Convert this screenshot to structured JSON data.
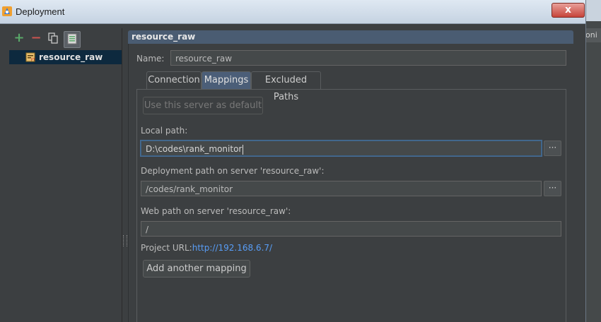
{
  "window": {
    "title": "Deployment",
    "close_label": "x"
  },
  "background": {
    "right_tab_text": "oni"
  },
  "sidebar": {
    "toolbar": {
      "add_label": "+",
      "remove_label": "−"
    },
    "servers": [
      {
        "label": "resource_raw"
      }
    ]
  },
  "panel": {
    "header": "resource_raw",
    "name_label": "Name:",
    "name_value": "resource_raw",
    "tabs": [
      {
        "label": "Connection"
      },
      {
        "label": "Mappings"
      },
      {
        "label": "Excluded Paths"
      }
    ],
    "use_default_label": "Use this server as default",
    "local_path_label": "Local path:",
    "local_path_value": "D:\\codes\\rank_monitor",
    "deploy_path_label": "Deployment path on server 'resource_raw':",
    "deploy_path_value": "/codes/rank_monitor",
    "web_path_label": "Web path on server 'resource_raw':",
    "web_path_value": "/",
    "project_url_label": "Project URL:",
    "project_url_value": "http://192.168.6.7/",
    "browse_label": "···",
    "add_mapping_label": "Add another mapping"
  },
  "colors": {
    "selection": "#0d293e",
    "header": "#4a5c72",
    "active_tab": "#4b5e78",
    "link": "#589df6",
    "add": "#59a869",
    "remove": "#c75450"
  }
}
